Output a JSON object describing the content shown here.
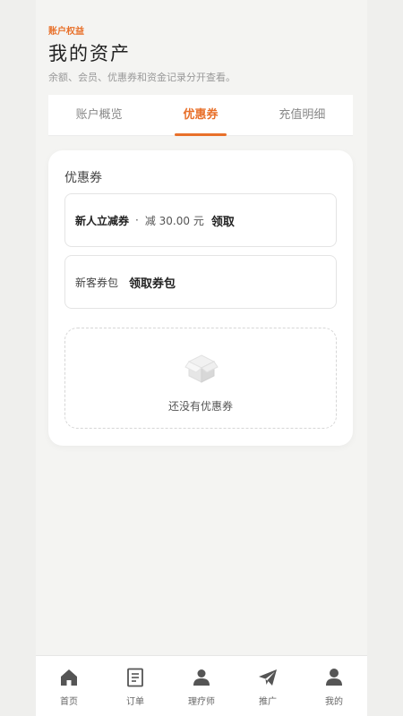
{
  "header": {
    "tag": "账户权益",
    "title": "我的资产",
    "subtitle": "余额、会员、优惠券和资金记录分开查看。"
  },
  "tabs": [
    {
      "label": "账户概览",
      "active": false
    },
    {
      "label": "优惠券",
      "active": true
    },
    {
      "label": "充值明细",
      "active": false
    }
  ],
  "coupons": {
    "title": "优惠券",
    "items": [
      {
        "name": "新人立减券",
        "separator": "·",
        "amount": "减 30.00 元",
        "action": "领取"
      },
      {
        "name": "新客券包",
        "action": "领取券包"
      }
    ],
    "empty_text": "还没有优惠券"
  },
  "tabbar": [
    {
      "label": "首页",
      "icon": "home-icon"
    },
    {
      "label": "订单",
      "icon": "order-icon"
    },
    {
      "label": "理疗师",
      "icon": "therapist-icon"
    },
    {
      "label": "推广",
      "icon": "send-icon"
    },
    {
      "label": "我的",
      "icon": "profile-icon"
    }
  ],
  "colors": {
    "accent": "#e8702a",
    "icon": "#555555"
  }
}
